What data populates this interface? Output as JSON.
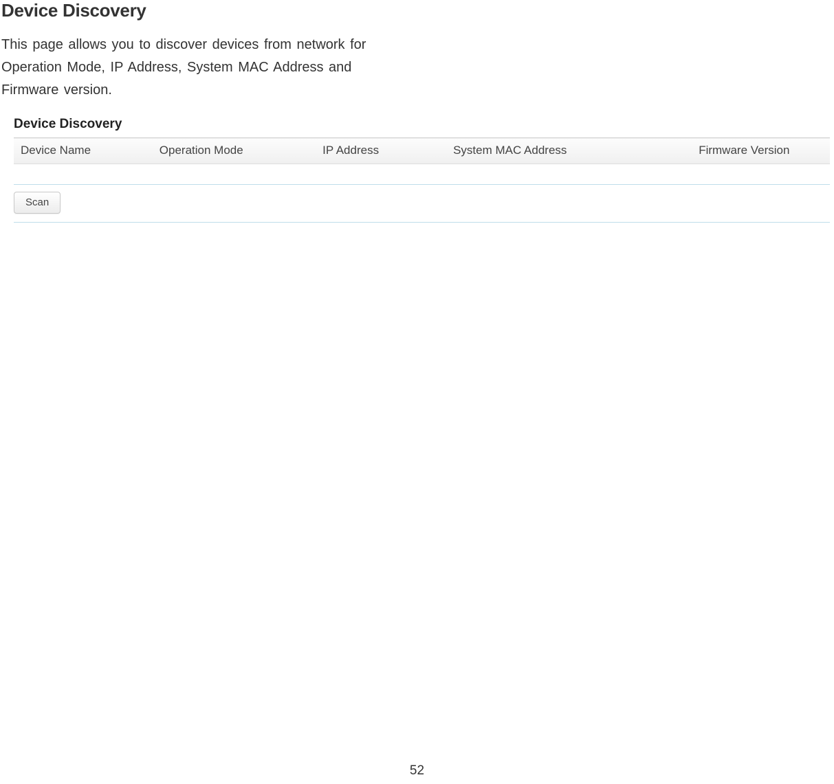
{
  "doc": {
    "title": "Device Discovery",
    "description": "This page allows you to discover devices from network for Operation Mode, IP Address, System MAC Address and Firmware version."
  },
  "panel": {
    "heading": "Device Discovery",
    "columns": [
      "Device Name",
      "Operation Mode",
      "IP Address",
      "System MAC Address",
      "Firmware Version"
    ],
    "rows": [],
    "scan_label": "Scan"
  },
  "page_number": "52"
}
